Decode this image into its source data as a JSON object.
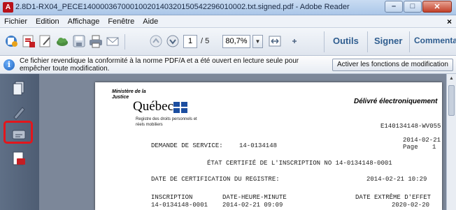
{
  "window": {
    "title": "2.8D1-RX04_PECE14000036700010020140320150542296010002.txt.signed.pdf - Adobe Reader",
    "controls": {
      "minimize": "–",
      "maximize": "□",
      "close": "✕"
    }
  },
  "menu": {
    "items": [
      "Fichier",
      "Edition",
      "Affichage",
      "Fenêtre",
      "Aide"
    ],
    "close_doc": "×"
  },
  "toolbar": {
    "page_current": "1",
    "page_total": "/ 5",
    "zoom": "80,7%",
    "zoom_dropdown": "▼",
    "tools_label": "Outils",
    "sign_label": "Signer",
    "comment_label": "Commentaire"
  },
  "infobar": {
    "message": "Ce fichier revendique la conformité à la norme PDF/A et a été ouvert en lecture seule pour empêcher toute modification.",
    "button": "Activer les fonctions de modification"
  },
  "document": {
    "ministere": "Ministère de la Justice",
    "quebec": "Québec",
    "registre": "Registre des droits personnels et réels mobiliers",
    "delivre": "Délivré électroniquement",
    "doc_id": "E140134148-WV055",
    "date": "2014-02-21",
    "page_label": "Page",
    "page_num": "1",
    "demande_label": "DEMANDE DE SERVICE:",
    "demande_value": "14-0134148",
    "etat": "ÉTAT CERTIFIÉ DE L'INSCRIPTION NO 14-0134148-0001",
    "date_cert_label": "DATE DE CERTIFICATION DU REGISTRE:",
    "date_cert_value": "2014-02-21 10:29",
    "col_inscription": "INSCRIPTION",
    "col_datetime": "DATE-HEURE-MINUTE",
    "col_date_extreme": "DATE EXTRÊME D'EFFET",
    "row1_inscription": "14-0134148-0001",
    "row1_datetime": "2014-02-21 09:09",
    "row1_date_extreme": "2020-02-20"
  }
}
